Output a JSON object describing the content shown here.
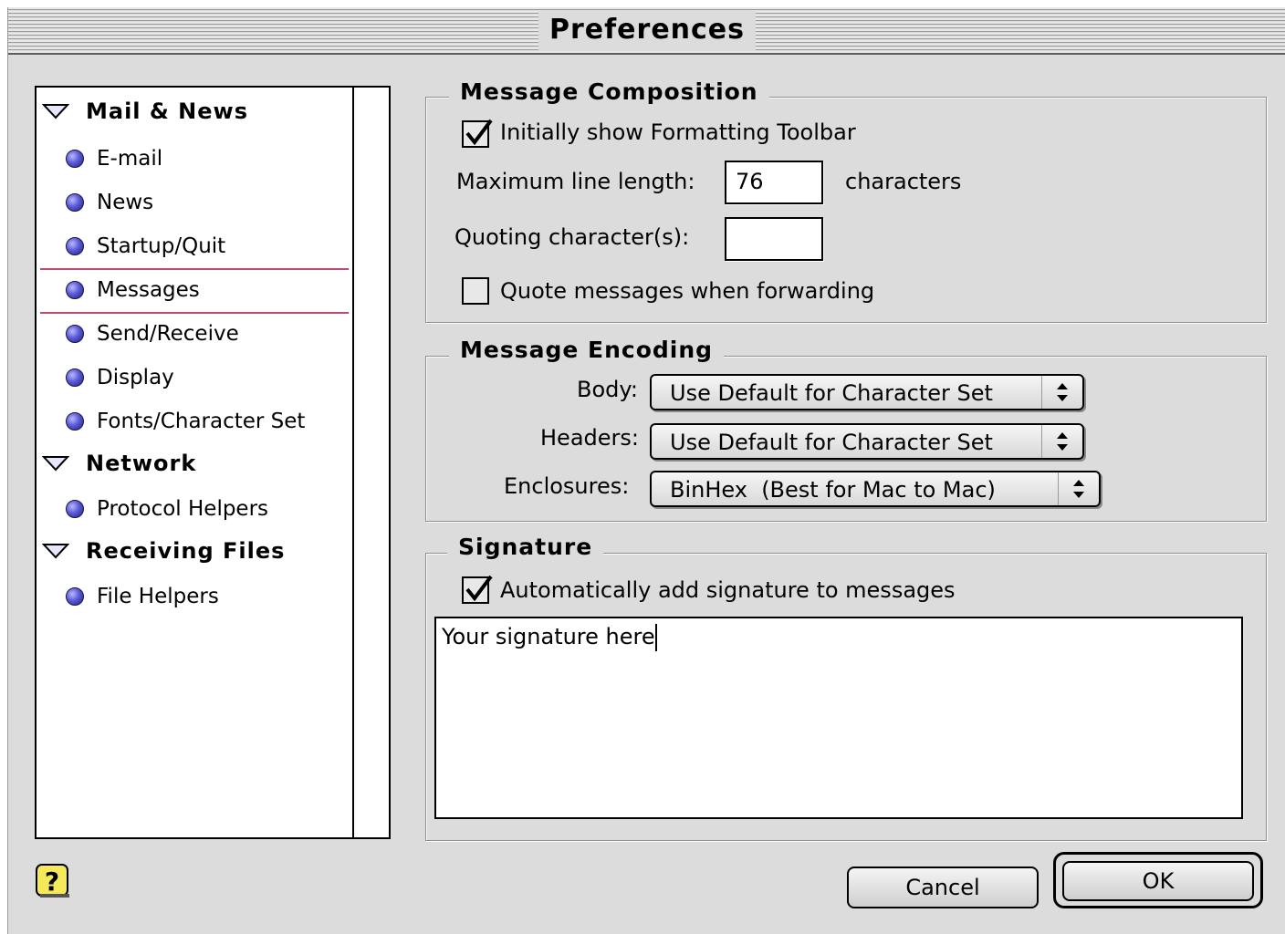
{
  "window": {
    "title": "Preferences"
  },
  "sidebar": {
    "groups": [
      {
        "label": "Mail & News"
      },
      {
        "label": "Network"
      },
      {
        "label": "Receiving Files"
      }
    ],
    "items": [
      {
        "label": "E-mail"
      },
      {
        "label": "News"
      },
      {
        "label": "Startup/Quit"
      },
      {
        "label": "Messages",
        "selected": true
      },
      {
        "label": "Send/Receive"
      },
      {
        "label": "Display"
      },
      {
        "label": "Fonts/Character Set"
      },
      {
        "label": "Protocol Helpers"
      },
      {
        "label": "File Helpers"
      }
    ]
  },
  "composition": {
    "title": "Message Composition",
    "show_toolbar_label": "Initially show Formatting Toolbar",
    "show_toolbar_checked": true,
    "max_line_label": "Maximum line length:",
    "max_line_value": "76",
    "max_line_unit": "characters",
    "quoting_label": "Quoting character(s):",
    "quoting_value": "",
    "quote_forward_label": "Quote messages when forwarding",
    "quote_forward_checked": false
  },
  "encoding": {
    "title": "Message Encoding",
    "body_label": "Body:",
    "body_value": "Use Default for Character Set",
    "headers_label": "Headers:",
    "headers_value": "Use Default for Character Set",
    "enclosures_label": "Enclosures:",
    "enclosures_value": "BinHex  (Best for Mac to Mac)"
  },
  "signature": {
    "title": "Signature",
    "auto_add_label": "Automatically add signature to messages",
    "auto_add_checked": true,
    "text": "Your signature here"
  },
  "buttons": {
    "cancel": "Cancel",
    "ok": "OK"
  },
  "icons": {
    "help": "help-question-icon",
    "expand": "disclosure-triangle-icon",
    "bullet": "blue-bullet-icon",
    "popup": "updown-arrows-icon"
  }
}
